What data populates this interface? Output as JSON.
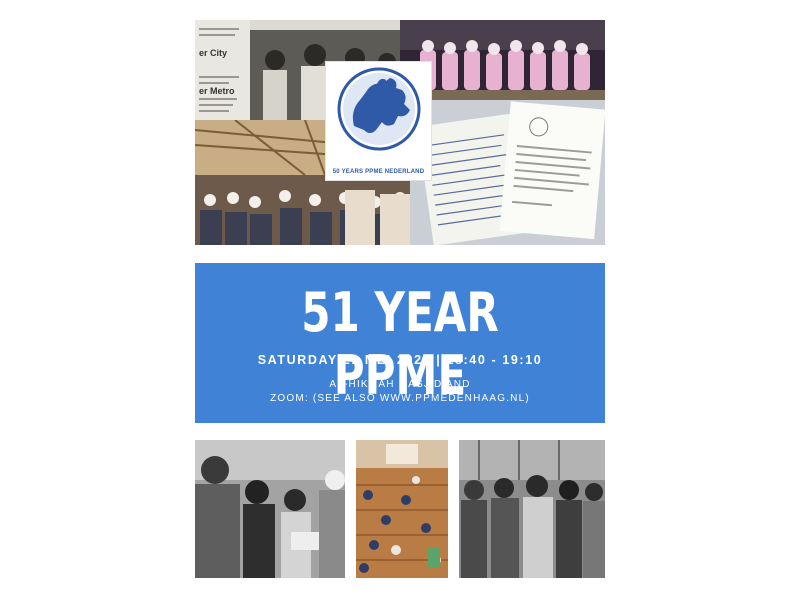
{
  "poster": {
    "title": "51 YEAR PPME",
    "date_line": "SATURDAY 21 MEI 2022 | 18:40 - 19:10",
    "location_line1": "AL-HIKMAH MASJID AND",
    "location_line2": "ZOOM: (SEE ALSO WWW.PPMEDENHAAG.NL)",
    "banner_color": "#3f82d6"
  },
  "logo": {
    "caption": "50 YEARS PPME NEDERLAND",
    "icon": "europe-globe-icon",
    "color": "#2e5aa8"
  },
  "photos": {
    "newspaper": {
      "icon": "newspaper-clipping-photo",
      "headline_1": "er City",
      "headline_2": "er Metro"
    },
    "choir": {
      "icon": "choir-performance-photo"
    },
    "hall": {
      "icon": "prayer-hall-gathering-photo"
    },
    "letters": {
      "icon": "historical-letters-photo"
    },
    "bw_left": {
      "icon": "black-white-historic-photo"
    },
    "mosque": {
      "icon": "mosque-interior-photo"
    },
    "bw_right": {
      "icon": "black-white-group-photo"
    }
  }
}
